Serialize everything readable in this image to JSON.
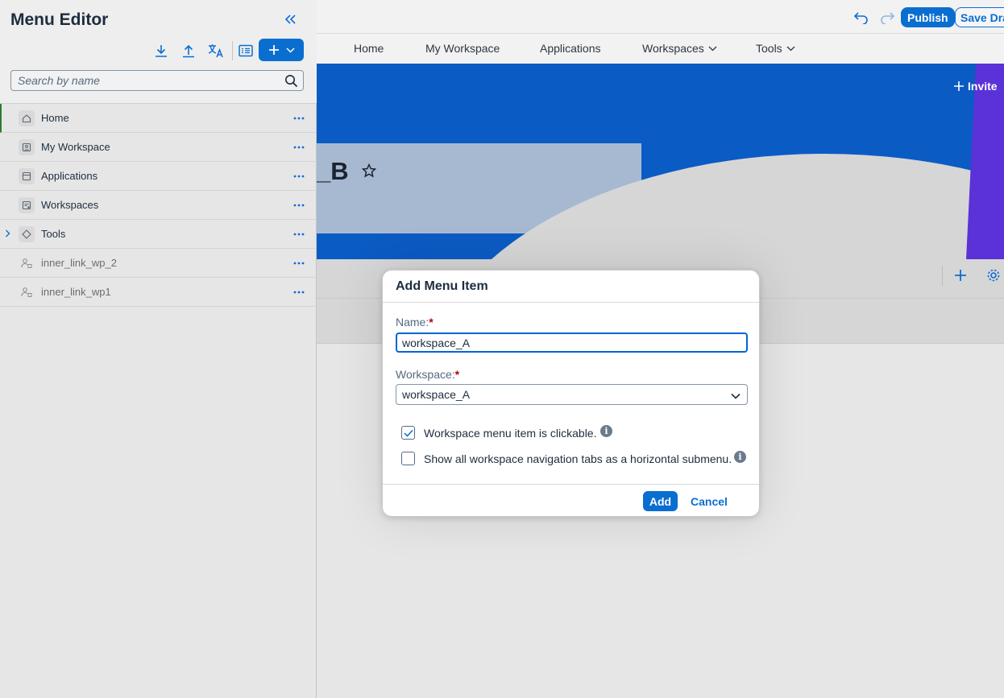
{
  "toolbar": {
    "publish_label": "Publish",
    "save_label": "Save Draft",
    "undo_icon": "undo-icon",
    "redo_icon": "redo-icon"
  },
  "nav": {
    "items": [
      {
        "label": "Home"
      },
      {
        "label": "My Workspace"
      },
      {
        "label": "Applications"
      },
      {
        "label": "Workspaces"
      },
      {
        "label": "Tools"
      }
    ]
  },
  "banner": {
    "title_fragment": "_B",
    "invite_label": "Invite"
  },
  "panel": {
    "title": "Menu Editor",
    "search_placeholder": "Search by name",
    "items": [
      {
        "label": "Home",
        "icon": "home-icon"
      },
      {
        "label": "My Workspace",
        "icon": "workspace-icon"
      },
      {
        "label": "Applications",
        "icon": "applications-icon"
      },
      {
        "label": "Workspaces",
        "icon": "workspaces-icon"
      },
      {
        "label": "Tools",
        "icon": "tools-icon"
      },
      {
        "label": "inner_link_wp_2",
        "icon": "link-icon"
      },
      {
        "label": "inner_link_wp1",
        "icon": "link-icon"
      }
    ]
  },
  "dialog": {
    "title": "Add Menu Item",
    "name_label": "Name:",
    "name_value": "workspace_A",
    "workspace_label": "Workspace:",
    "workspace_value": "workspace_A",
    "required_mark": "*",
    "checkbox1_label": "Workspace menu item is clickable.",
    "checkbox1_checked": true,
    "checkbox2_label": "Show all workspace navigation tabs as a horizontal submenu.",
    "checkbox2_checked": false,
    "add_label": "Add",
    "cancel_label": "Cancel"
  },
  "colors": {
    "accent": "#0a6ed1",
    "banner": "#0b5bc4",
    "purple": "#5b32d7"
  }
}
